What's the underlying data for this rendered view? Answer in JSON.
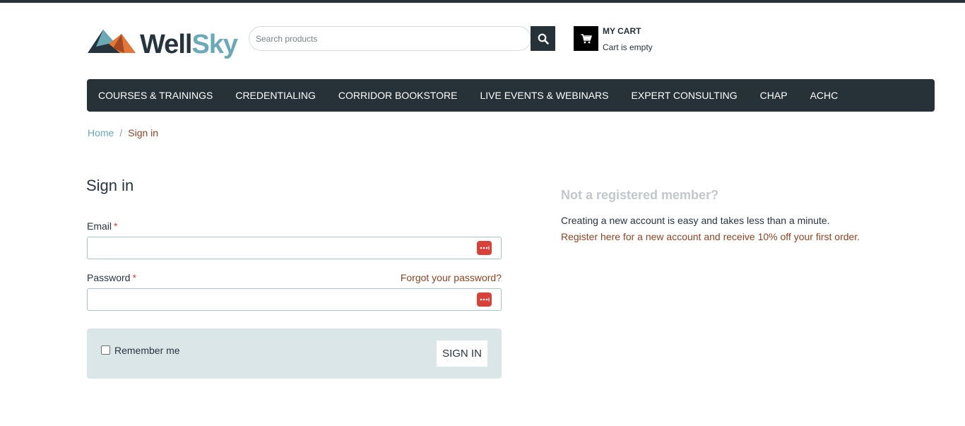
{
  "header": {
    "logo": {
      "text_part1": "Well",
      "text_part2": "Sky"
    },
    "search": {
      "placeholder": "Search products",
      "value": ""
    },
    "cart": {
      "title": "MY CART",
      "status": "Cart is empty"
    }
  },
  "nav": {
    "items": [
      "COURSES & TRAININGS",
      "CREDENTIALING",
      "CORRIDOR BOOKSTORE",
      "LIVE EVENTS & WEBINARS",
      "EXPERT CONSULTING",
      "CHAP",
      "ACHC"
    ]
  },
  "breadcrumb": {
    "home": "Home",
    "separator": "/",
    "current": "Sign in"
  },
  "signin": {
    "title": "Sign in",
    "email_label": "Email",
    "email_value": "",
    "password_label": "Password",
    "password_value": "",
    "required_mark": "*",
    "forgot_link": "Forgot your password?",
    "remember_label": "Remember me",
    "remember_checked": false,
    "button_label": "SIGN IN"
  },
  "register": {
    "heading": "Not a registered member?",
    "text": "Creating a new account is easy and takes less than a minute.",
    "link": "Register here for a new account and receive 10% off your first order."
  },
  "colors": {
    "nav_bg": "#263238",
    "accent_teal": "#6aa9b6",
    "link_brown": "#8a4526",
    "required_red": "#d0423a",
    "remember_bg": "#dbe6e8"
  },
  "icons": {
    "search": "search-icon",
    "cart": "cart-icon",
    "password_manager": "password-manager-icon"
  }
}
